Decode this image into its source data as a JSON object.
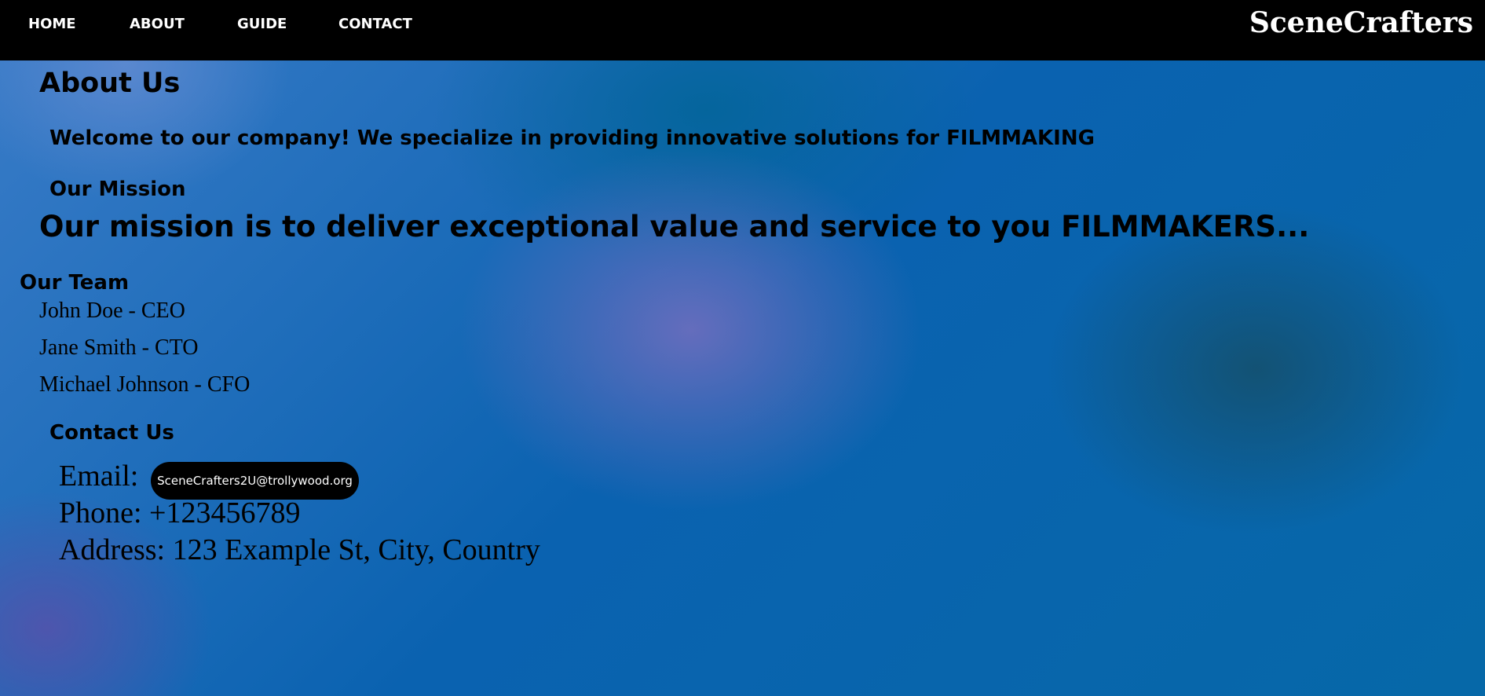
{
  "nav": {
    "items": [
      "HOME",
      "ABOUT",
      "GUIDE",
      "CONTACT"
    ],
    "brand": "SceneCrafters"
  },
  "about": {
    "title": "About Us",
    "welcome": "Welcome to our company! We specialize in providing innovative solutions for FILMMAKING",
    "mission_heading": "Our Mission",
    "mission_text": "Our mission is to deliver exceptional value and service to you FILMMAKERS...",
    "team_heading": "Our Team",
    "team": [
      "John Doe - CEO",
      "Jane Smith - CTO",
      "Michael Johnson - CFO"
    ],
    "contact_heading": "Contact Us",
    "email_label": "Email:",
    "email": "SceneCrafters2U@trollywood.org",
    "phone": "Phone: +123456789",
    "address": "Address: 123 Example St, City, Country"
  }
}
